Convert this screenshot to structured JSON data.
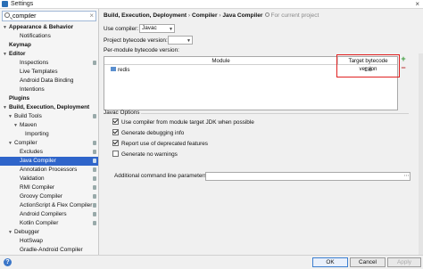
{
  "window": {
    "title": "Settings",
    "close_glyph": "×"
  },
  "search": {
    "value": "compiler",
    "clear_glyph": "×"
  },
  "tree": [
    {
      "label": "Appearance & Behavior",
      "level": 0,
      "arrow": "▼",
      "bold": true
    },
    {
      "label": "Notifications",
      "level": 2,
      "bold": false
    },
    {
      "label": "Keymap",
      "level": 0,
      "bold": true
    },
    {
      "label": "Editor",
      "level": 0,
      "arrow": "▼",
      "bold": true
    },
    {
      "label": "Inspections",
      "level": 2,
      "bold": false,
      "ptr": true
    },
    {
      "label": "Live Templates",
      "level": 2,
      "bold": false
    },
    {
      "label": "Android Data Binding",
      "level": 2,
      "bold": false
    },
    {
      "label": "Intentions",
      "level": 2,
      "bold": false
    },
    {
      "label": "Plugins",
      "level": 0,
      "bold": true
    },
    {
      "label": "Build, Execution, Deployment",
      "level": 0,
      "arrow": "▼",
      "bold": true
    },
    {
      "label": "Build Tools",
      "level": 1,
      "arrow": "▼",
      "bold": false,
      "ptr": true
    },
    {
      "label": "Maven",
      "level": 2,
      "arrow": "▼",
      "bold": false
    },
    {
      "label": "Importing",
      "level": 3,
      "bold": false
    },
    {
      "label": "Compiler",
      "level": 1,
      "arrow": "▼",
      "bold": false,
      "ptr": true
    },
    {
      "label": "Excludes",
      "level": 2,
      "bold": false,
      "ptr": true
    },
    {
      "label": "Java Compiler",
      "level": 2,
      "bold": false,
      "selected": true,
      "ptr": true
    },
    {
      "label": "Annotation Processors",
      "level": 2,
      "bold": false,
      "ptr": true
    },
    {
      "label": "Validation",
      "level": 2,
      "bold": false,
      "ptr": true
    },
    {
      "label": "RMI Compiler",
      "level": 2,
      "bold": false,
      "ptr": true
    },
    {
      "label": "Groovy Compiler",
      "level": 2,
      "bold": false,
      "ptr": true
    },
    {
      "label": "ActionScript & Flex Compiler",
      "level": 2,
      "bold": false,
      "ptr": true
    },
    {
      "label": "Android Compilers",
      "level": 2,
      "bold": false,
      "ptr": true
    },
    {
      "label": "Kotlin Compiler",
      "level": 2,
      "bold": false,
      "ptr": true
    },
    {
      "label": "Debugger",
      "level": 1,
      "arrow": "▼",
      "bold": false
    },
    {
      "label": "HotSwap",
      "level": 2,
      "bold": false
    },
    {
      "label": "Gradle-Android Compiler",
      "level": 2,
      "bold": false
    }
  ],
  "breadcrumb": {
    "part1": "Build, Execution, Deployment",
    "sep1": " › ",
    "part2": "Compiler",
    "sep2": " › ",
    "part3": "Java Compiler",
    "note": "For current project"
  },
  "form": {
    "use_compiler_label": "Use compiler:",
    "use_compiler_value": "Javac",
    "bytecode_label": "Project bytecode version:",
    "bytecode_value": "",
    "per_module_label": "Per-module bytecode version:"
  },
  "table": {
    "col_module": "Module",
    "col_target": "Target bytecode version",
    "rows": [
      {
        "module": "redis",
        "target": "1.8"
      }
    ],
    "add_glyph": "+",
    "remove_glyph": "−"
  },
  "javac_options": {
    "title": "Javac Options",
    "checks": [
      {
        "label": "Use compiler from module target JDK when possible",
        "checked": true
      },
      {
        "label": "Generate debugging info",
        "checked": true
      },
      {
        "label": "Report use of deprecated features",
        "checked": true
      },
      {
        "label": "Generate no warnings",
        "checked": false
      }
    ],
    "params_label": "Additional command line parameters:",
    "params_value": "",
    "expand_glyph": "⋯"
  },
  "buttons": {
    "help": "?",
    "ok": "OK",
    "cancel": "Cancel",
    "apply": "Apply"
  },
  "colors": {
    "selection": "#2f65ca",
    "highlight_border": "#e02020"
  }
}
